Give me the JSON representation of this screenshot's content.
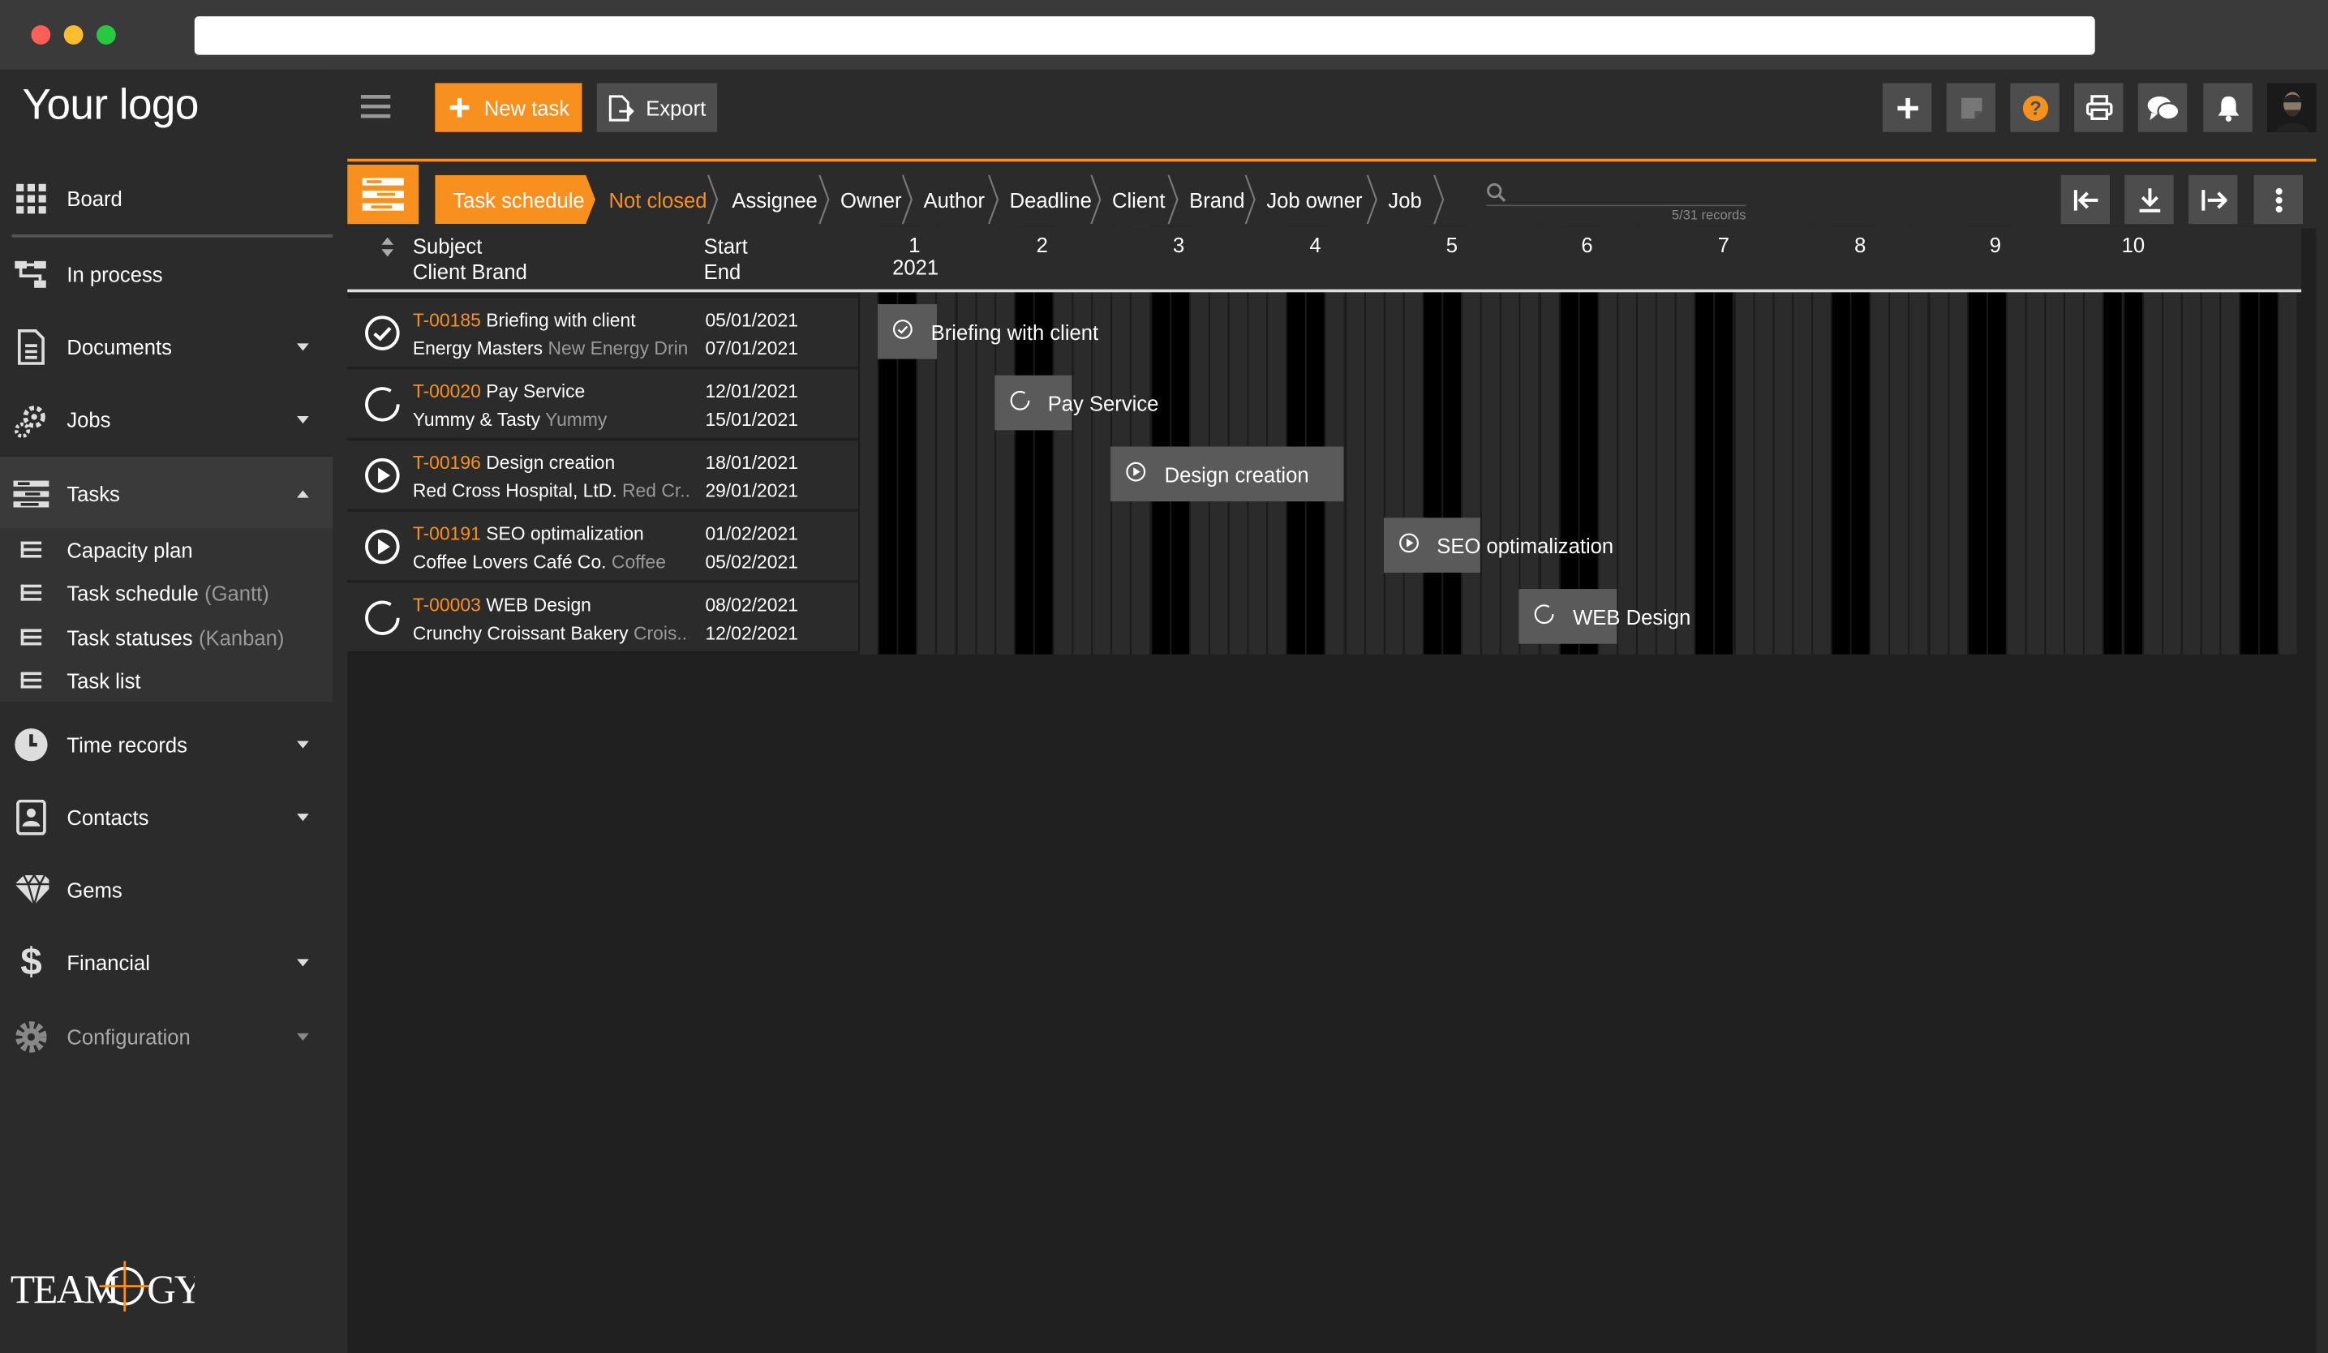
{
  "sidebar": {
    "logo": "Your logo",
    "items": [
      {
        "label": "Board",
        "icon": "grid-icon"
      },
      {
        "label": "In process",
        "icon": "process-icon"
      },
      {
        "label": "Documents",
        "icon": "document-icon"
      },
      {
        "label": "Jobs",
        "icon": "gears-icon"
      },
      {
        "label": "Tasks",
        "icon": "tasks-icon"
      },
      {
        "label": "Time records",
        "icon": "clock-icon"
      },
      {
        "label": "Contacts",
        "icon": "contact-book-icon"
      },
      {
        "label": "Gems",
        "icon": "diamond-icon"
      },
      {
        "label": "Financial",
        "icon": "dollar-icon"
      },
      {
        "label": "Configuration",
        "icon": "gear-icon"
      }
    ],
    "subitems": [
      {
        "label": "Capacity plan",
        "hint": ""
      },
      {
        "label": "Task schedule",
        "hint": "(Gantt)"
      },
      {
        "label": "Task statuses",
        "hint": "(Kanban)"
      },
      {
        "label": "Task list",
        "hint": ""
      }
    ],
    "brand": "TEAMOGY"
  },
  "toolbar": {
    "new_task": "New task",
    "export": "Export"
  },
  "filters": {
    "view": "Task schedule",
    "crumbs": [
      "Not closed",
      "Assignee",
      "Owner",
      "Author",
      "Deadline",
      "Client",
      "Brand",
      "Job owner",
      "Job"
    ],
    "records": "5/31 records"
  },
  "gantt": {
    "col_subject": "Subject",
    "col_client": "Client Brand",
    "col_start": "Start",
    "col_end": "End",
    "weeks": [
      "1",
      "2",
      "3",
      "4",
      "5",
      "6",
      "7",
      "8",
      "9",
      "10"
    ],
    "year": "2021",
    "tasks": [
      {
        "id": "T-00185",
        "subject": "Briefing with client",
        "client": "Energy Masters",
        "brand": "New Energy Drink",
        "start": "05/01/2021",
        "end": "07/01/2021",
        "status": "done"
      },
      {
        "id": "T-00020",
        "subject": "Pay Service",
        "client": "Yummy & Tasty",
        "brand": "Yummy",
        "start": "12/01/2021",
        "end": "15/01/2021",
        "status": "open"
      },
      {
        "id": "T-00196",
        "subject": "Design creation",
        "client": "Red Cross Hospital, LtD.",
        "brand": "Red Cr...",
        "start": "18/01/2021",
        "end": "29/01/2021",
        "status": "running"
      },
      {
        "id": "T-00191",
        "subject": "SEO optimalization",
        "client": "Coffee Lovers Café Co.",
        "brand": "Coffee",
        "start": "01/02/2021",
        "end": "05/02/2021",
        "status": "running"
      },
      {
        "id": "T-00003",
        "subject": "WEB Design",
        "client": "Crunchy Croissant Bakery",
        "brand": "Crois...",
        "start": "08/02/2021",
        "end": "12/02/2021",
        "status": "open"
      }
    ]
  },
  "colors": {
    "accent": "#f7901e",
    "bg": "#2b2b2b",
    "panel": "#202020"
  }
}
